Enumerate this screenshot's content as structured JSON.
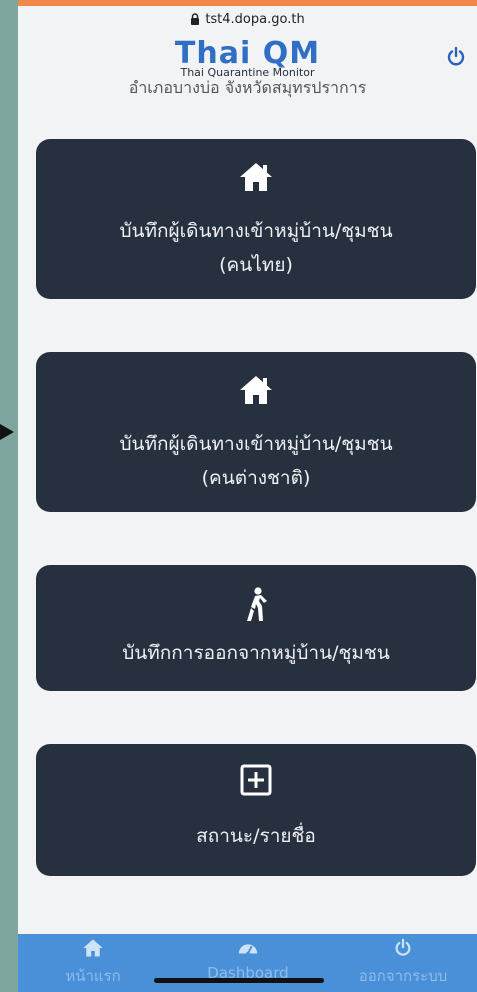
{
  "browser": {
    "url": "tst4.dopa.go.th"
  },
  "header": {
    "brand": "Thai QM",
    "brand_sub": "Thai Quarantine Monitor",
    "location": "อำเภอบางบ่อ จังหวัดสมุทรปราการ"
  },
  "cards": [
    {
      "icon": "home-icon",
      "line1": "บันทึกผู้เดินทางเข้าหมู่บ้าน/ชุมชน",
      "line2": "(คนไทย)"
    },
    {
      "icon": "home-icon",
      "line1": "บันทึกผู้เดินทางเข้าหมู่บ้าน/ชุมชน",
      "line2": "(คนต่างชาติ)"
    },
    {
      "icon": "walking-person-icon",
      "line1": "บันทึกการออกจากหมู่บ้าน/ชุมชน"
    },
    {
      "icon": "plus-square-icon",
      "line1": "สถานะ/รายชื่อ"
    }
  ],
  "bottom_nav": {
    "items": [
      {
        "icon": "home-icon",
        "label": "หน้าแรก"
      },
      {
        "icon": "dashboard-gauge-icon",
        "label": "Dashboard"
      },
      {
        "icon": "power-icon",
        "label": "ออกจากระบบ"
      }
    ]
  },
  "colors": {
    "card_bg": "#27303f",
    "nav_bg": "#4a90d9",
    "brand": "#2f6fc4",
    "page_bg": "#f2f3f4"
  }
}
